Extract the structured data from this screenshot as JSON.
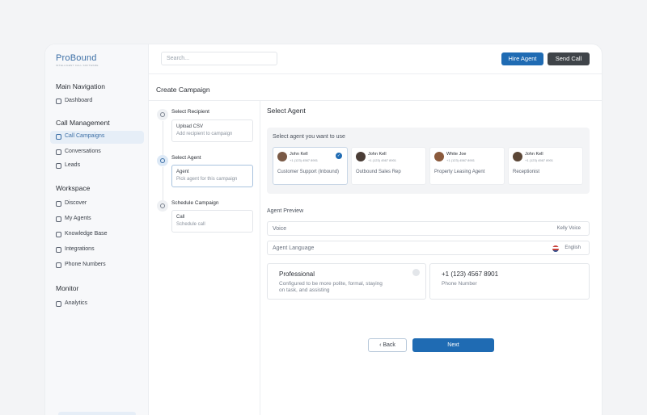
{
  "app": {
    "logo": "ProBound",
    "logo_tagline": "INTELLIGENT CALL SOFTWARE"
  },
  "header": {
    "search_placeholder": "Search...",
    "hire_agent": "Hire Agent",
    "send_call": "Send Call"
  },
  "sidebar": {
    "sections": [
      {
        "title": "Main Navigation",
        "items": [
          {
            "label": "Dashboard",
            "icon": "grid-icon"
          }
        ]
      },
      {
        "title": "Call Management",
        "items": [
          {
            "label": "Call Campaigns",
            "icon": "phone-icon",
            "active": true
          },
          {
            "label": "Conversations",
            "icon": "chat-icon"
          },
          {
            "label": "Leads",
            "icon": "users-icon"
          }
        ]
      },
      {
        "title": "Workspace",
        "items": [
          {
            "label": "Discover",
            "icon": "compass-icon"
          },
          {
            "label": "My Agents",
            "icon": "user-circle-icon"
          },
          {
            "label": "Knowledge Base",
            "icon": "folder-icon"
          },
          {
            "label": "Integrations",
            "icon": "sync-icon"
          },
          {
            "label": "Phone Numbers",
            "icon": "phone-book-icon"
          }
        ]
      },
      {
        "title": "Monitor",
        "items": [
          {
            "label": "Analytics",
            "icon": "chart-icon"
          }
        ]
      }
    ]
  },
  "main": {
    "title": "Create Campaign",
    "steps": [
      {
        "title": "Select Recipient",
        "box_title": "Upload CSV",
        "box_sub": "Add recipient to campaign",
        "icon": "users-icon"
      },
      {
        "title": "Select Agent",
        "box_title": "Agent",
        "box_sub": "Pick agent for this campaign",
        "icon": "user-icon",
        "active": true
      },
      {
        "title": "Schedule Campaign",
        "box_title": "Call",
        "box_sub": "Schedule call",
        "icon": "phone-icon"
      }
    ],
    "agent_section_title": "Select Agent",
    "agent_prompt": "Select agent you want to use",
    "agents": [
      {
        "name": "John Kell",
        "phone": "+1 (123) 4567 8901",
        "role": "Customer Support (Inbound)",
        "selected": true
      },
      {
        "name": "John Kell",
        "phone": "+1 (123) 4567 8901",
        "role": "Outbound Sales Rep"
      },
      {
        "name": "White Joe",
        "phone": "+1 (123) 4567 8901",
        "role": "Property Leasing Agent"
      },
      {
        "name": "John Kell",
        "phone": "+1 (123) 4567 8901",
        "role": "Receptionist"
      }
    ],
    "preview": {
      "title": "Agent Preview",
      "voice_label": "Voice",
      "voice_value": "Kelly Voice",
      "language_label": "Agent Language",
      "language_value": "English",
      "style_title": "Professional",
      "style_desc": "Configured to be more polite, formal, staying on task, and assisting",
      "phone_title": "+1 (123) 4567 8901",
      "phone_sub": "Phone Number"
    },
    "back_label": "Back",
    "next_label": "Next"
  }
}
